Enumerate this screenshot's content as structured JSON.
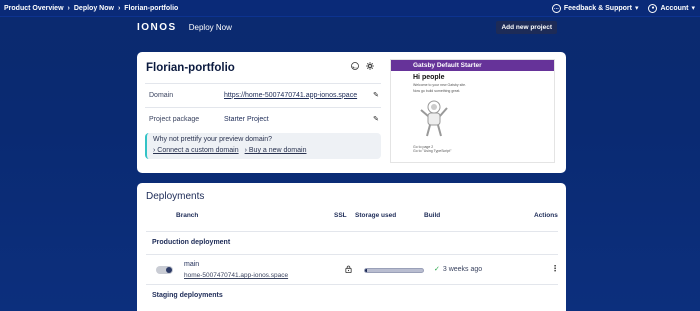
{
  "topbar": {
    "breadcrumbs": [
      "Product Overview",
      "Deploy Now",
      "Florian-portfolio"
    ],
    "feedback_label": "Feedback & Support",
    "account_label": "Account"
  },
  "brand": {
    "logo": "IONOS",
    "product": "Deploy Now",
    "add_project_label": "Add new project"
  },
  "project": {
    "name": "Florian-portfolio",
    "domain_label": "Domain",
    "domain_value": "https://home-5007470741.app-ionos.space",
    "package_label": "Project package",
    "package_value": "Starter Project",
    "promo_text": "Why not prettify your preview domain?",
    "promo_link_1": "› Connect a custom domain",
    "promo_link_2": "› Buy a new domain",
    "preview": {
      "bar_title": "Gatsby Default Starter",
      "heading": "Hi people",
      "text_1": "Welcome to your new Gatsby site.",
      "text_2": "Now go build something great.",
      "footer_1": "Go to page 2",
      "footer_2": "Go to \"Using TypeScript\""
    }
  },
  "deployments": {
    "title": "Deployments",
    "columns": {
      "branch": "Branch",
      "ssl": "SSL",
      "storage": "Storage used",
      "build": "Build",
      "actions": "Actions"
    },
    "production_label": "Production deployment",
    "staging_label": "Staging deployments",
    "rows": [
      {
        "branch": "main",
        "url": "home-5007470741.app-ionos.space",
        "build": "3 weeks ago",
        "storage_fraction": 0.04
      }
    ]
  },
  "colors": {
    "background": "#0a2a72",
    "accent_purple": "#663399",
    "success": "#2aa84a"
  }
}
